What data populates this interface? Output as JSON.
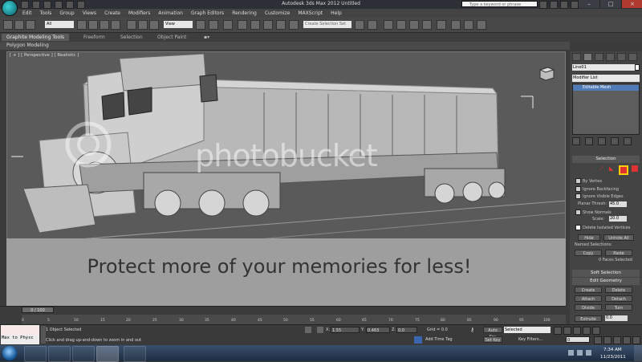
{
  "window": {
    "title": "Autodesk 3ds Max 2012    Untitled",
    "search_placeholder": "Type a keyword or phrase"
  },
  "menu": [
    "Edit",
    "Tools",
    "Group",
    "Views",
    "Create",
    "Modifiers",
    "Animation",
    "Graph Editors",
    "Rendering",
    "Customize",
    "MAXScript",
    "Help"
  ],
  "toolbar": {
    "selection_filter": "All",
    "reference_coord": "View",
    "named_selection": "Create Selection Set"
  },
  "ribbon": {
    "tabs": [
      "Graphite Modeling Tools",
      "Freeform",
      "Selection",
      "Object Paint"
    ],
    "panel_label": "Polygon Modeling"
  },
  "viewport": {
    "label": "[ + ] [ Perspective ] [ Realistic ]"
  },
  "watermark": {
    "brand": "photobucket",
    "promo": "Protect more of your memories for less!"
  },
  "command_panel": {
    "object_name": "Line01",
    "modifier_list": "Modifier List",
    "stack_item": "Editable Mesh",
    "selection_header": "Selection",
    "by_vertex": "By Vertex",
    "ignore_backfacing": "Ignore Backfacing",
    "ignore_visible_edges": "Ignore Visible Edges",
    "planar_thresh_label": "Planar Thresh:",
    "planar_thresh_value": "45.0",
    "show_normals": "Show Normals",
    "scale_label": "Scale:",
    "scale_value": "20.0",
    "delete_isolated": "Delete Isolated Vertices",
    "hide": "Hide",
    "unhide_all": "Unhide All",
    "named_selections": "Named Selections:",
    "copy": "Copy",
    "paste": "Paste",
    "faces_selected": "0 Faces Selected",
    "soft_selection": "Soft Selection",
    "edit_geometry": "Edit Geometry",
    "create": "Create",
    "delete": "Delete",
    "attach": "Attach",
    "detach": "Detach",
    "divide": "Divide",
    "turn": "Turn",
    "extrude": "Extrude",
    "extrude_value": "0.0"
  },
  "timeline": {
    "frame": "0 / 100",
    "ticks": [
      "0",
      "5",
      "10",
      "15",
      "20",
      "25",
      "30",
      "35",
      "40",
      "45",
      "50",
      "55",
      "60",
      "65",
      "70",
      "75",
      "80",
      "85",
      "90",
      "95",
      "100"
    ]
  },
  "status": {
    "listener": "Max to Physc",
    "objects_selected": "1 Object Selected",
    "prompt": "Click and drag up-and-down to zoom in and out",
    "x_label": "X:",
    "x_value": "1.55",
    "y_label": "Y:",
    "y_value": "0.463",
    "z_label": "Z:",
    "z_value": "0.0",
    "grid": "Grid = 0.0",
    "auto_key": "Auto Key",
    "selected": "Selected",
    "set_key": "Set Key",
    "key_filters": "Key Filters...",
    "add_time_tag": "Add Time Tag",
    "frame_value": "0"
  },
  "taskbar": {
    "time": "7:34 AM",
    "date": "11/23/2011"
  },
  "colors": {
    "accent": "#4f7bb8",
    "background": "#3b3b3b",
    "viewport": "#5a5a5a"
  }
}
